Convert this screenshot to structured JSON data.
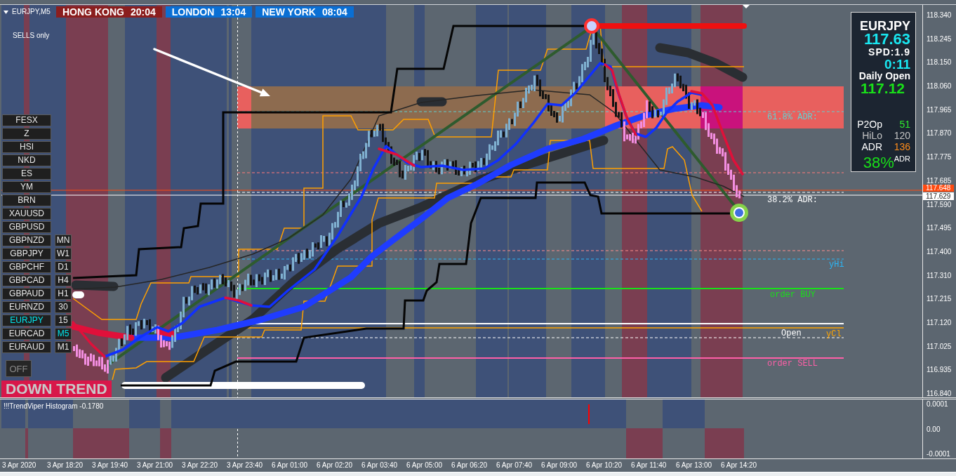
{
  "chart": {
    "title": "EURJPY,M5",
    "mode_label": "SELLS only"
  },
  "sessions": [
    {
      "name": "HONG KONG",
      "time": "20:04",
      "color": "#8b1e1e"
    },
    {
      "name": "LONDON",
      "time": "13:04",
      "color": "#0a6fd4"
    },
    {
      "name": "NEW YORK",
      "time": "08:04",
      "color": "#0a6fd4"
    }
  ],
  "symbol_buttons": [
    {
      "label": "FESX",
      "selected": false
    },
    {
      "label": "Z",
      "selected": false
    },
    {
      "label": "HSI",
      "selected": false
    },
    {
      "label": "NKD",
      "selected": false
    },
    {
      "label": "ES",
      "selected": false
    },
    {
      "label": "YM",
      "selected": false
    },
    {
      "label": "BRN",
      "selected": false
    },
    {
      "label": "XAUUSD",
      "selected": false
    },
    {
      "label": "GBPUSD",
      "selected": false
    },
    {
      "label": "GBPNZD",
      "selected": false
    },
    {
      "label": "GBPJPY",
      "selected": false
    },
    {
      "label": "GBPCHF",
      "selected": false
    },
    {
      "label": "GBPCAD",
      "selected": false
    },
    {
      "label": "GBPAUD",
      "selected": false
    },
    {
      "label": "EURNZD",
      "selected": false
    },
    {
      "label": "EURJPY",
      "selected": true
    },
    {
      "label": "EURCAD",
      "selected": false
    },
    {
      "label": "EURAUD",
      "selected": false
    }
  ],
  "timeframe_buttons": [
    {
      "label": "MN",
      "selected": false
    },
    {
      "label": "W1",
      "selected": false
    },
    {
      "label": "D1",
      "selected": false
    },
    {
      "label": "H4",
      "selected": false
    },
    {
      "label": "H1",
      "selected": false
    },
    {
      "label": "30",
      "selected": false
    },
    {
      "label": "15",
      "selected": false
    },
    {
      "label": "M5",
      "selected": true
    },
    {
      "label": "M1",
      "selected": false
    }
  ],
  "toggle_button": {
    "label": "OFF",
    "on": false
  },
  "trend_banner": {
    "label": "DOWN TREND",
    "kind": "down"
  },
  "level_labels": [
    {
      "label": "61.8% ADR:",
      "color": "#5fd4d4"
    },
    {
      "label": "38.2% ADR:",
      "color": "#ffffff"
    },
    {
      "label": "yHi",
      "color": "#2bb6f6"
    },
    {
      "label": "order BUY",
      "color": "#19e019"
    },
    {
      "label": "Open",
      "color": "#ffffff"
    },
    {
      "label": "yCl",
      "color": "#ffa500"
    },
    {
      "label": "order SELL",
      "color": "#ff5fa8"
    }
  ],
  "info_panel": {
    "symbol": "EURJPY",
    "price": "117.63",
    "spread": "SPD:1.9",
    "countdown": "0:11",
    "daily_open_label": "Daily Open",
    "daily_open": "117.12",
    "stats": [
      {
        "label": "P2Op",
        "value": "51",
        "color": "#2ee82e",
        "muted": false
      },
      {
        "label": "HiLo",
        "value": "120",
        "color": "#c4c4c4",
        "muted": true
      },
      {
        "label": "ADR",
        "value": "136",
        "color": "#ff8c1a",
        "muted": false
      }
    ],
    "adr_percent": "38%",
    "adr_suffix": "ADR"
  },
  "price_axis": {
    "ticks": [
      "118.340",
      "118.245",
      "118.150",
      "118.060",
      "117.965",
      "117.870",
      "117.775",
      "117.685",
      "117.590",
      "117.495",
      "117.400",
      "117.310",
      "117.215",
      "117.120",
      "117.025",
      "116.935",
      "116.840"
    ],
    "ask_tag": "117.648",
    "bid_tag": "117.629"
  },
  "indicator": {
    "title": "!!!TrendViper Histogram -0.1780",
    "ticks": [
      "0.0001",
      "0.00",
      "-0.0001"
    ]
  },
  "time_axis": [
    "3 Apr 2020",
    "3 Apr 18:20",
    "3 Apr 19:40",
    "3 Apr 21:00",
    "3 Apr 22:20",
    "3 Apr 23:40",
    "6 Apr 01:00",
    "6 Apr 02:20",
    "6 Apr 03:40",
    "6 Apr 05:00",
    "6 Apr 06:20",
    "6 Apr 07:40",
    "6 Apr 09:00",
    "6 Apr 10:20",
    "6 Apr 11:40",
    "6 Apr 13:00",
    "6 Apr 14:20"
  ]
}
